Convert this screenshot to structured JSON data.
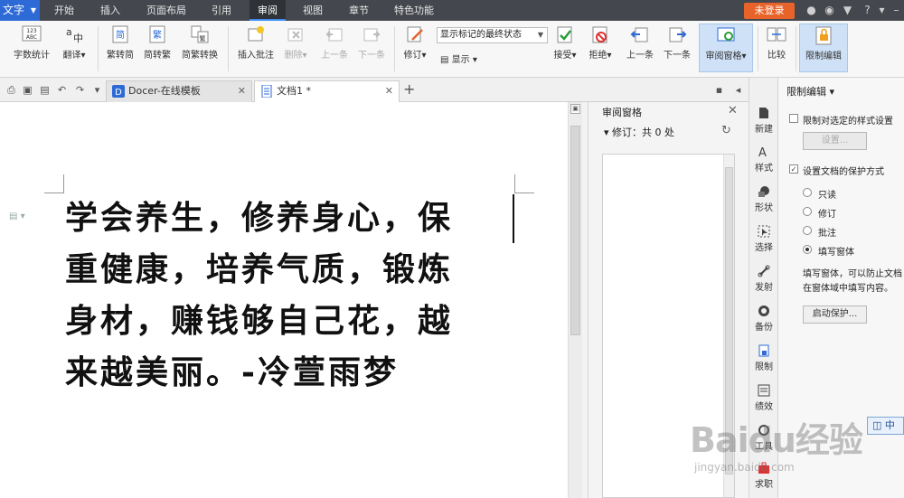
{
  "menubar": {
    "app_label": "文字",
    "tabs": [
      "开始",
      "插入",
      "页面布局",
      "引用",
      "审阅",
      "视图",
      "章节",
      "特色功能"
    ],
    "active_tab": "审阅",
    "login_label": "未登录"
  },
  "ribbon": {
    "word_count": "字数统计",
    "word_count_badge": "123 ABC",
    "translate": "翻译",
    "trad_to_simp": "繁转简",
    "simp_to_trad": "简转繁",
    "simp_trad_convert": "简繁转换",
    "insert_comment": "插入批注",
    "delete": "删除",
    "prev_comment": "上一条",
    "next_comment": "下一条",
    "track_changes": "修订",
    "show_marks_value": "显示标记的最终状态",
    "show": "显示",
    "accept": "接受",
    "reject": "拒绝",
    "prev_change": "上一条",
    "next_change": "下一条",
    "review_pane": "审阅窗格",
    "compare": "比较",
    "restrict_editing": "限制编辑"
  },
  "tabs": {
    "items": [
      {
        "label": "Docer-在线模板"
      },
      {
        "label": "文档1 *"
      }
    ]
  },
  "document": {
    "lines": [
      "学会养生，修养身心，保",
      "重健康，培养气质，锻炼",
      "身材，赚钱够自己花，越",
      "来越美丽。-冷萱雨梦"
    ]
  },
  "review_pane": {
    "title": "审阅窗格",
    "revision_count": "修订：共 0 处"
  },
  "sidebar": {
    "items": [
      {
        "label": "新建",
        "icon": "new-icon"
      },
      {
        "label": "样式",
        "icon": "style-icon"
      },
      {
        "label": "形状",
        "icon": "shape-icon"
      },
      {
        "label": "选择",
        "icon": "select-icon"
      },
      {
        "label": "发射",
        "icon": "link-icon"
      },
      {
        "label": "备份",
        "icon": "backup-icon"
      },
      {
        "label": "限制",
        "icon": "restrict-icon"
      },
      {
        "label": "绩效",
        "icon": "performance-icon"
      },
      {
        "label": "工具",
        "icon": "tools-icon"
      },
      {
        "label": "求职",
        "icon": "job-icon"
      }
    ]
  },
  "restrict_panel": {
    "title": "限制编辑",
    "limit_styles": "限制对选定的样式设置",
    "settings_btn": "设置...",
    "set_protection": "设置文档的保护方式",
    "options": [
      "只读",
      "修订",
      "批注",
      "填写窗体"
    ],
    "selected_option": "填写窗体",
    "desc_line1": "填写窗体，可以防止文档",
    "desc_line2": "在窗体域中填写内容。",
    "start_protect_btn": "启动保护...",
    "lang_button": "中"
  },
  "watermark": {
    "text": "Baidu经验",
    "sub": "jingyan.baidu.com"
  },
  "colors": {
    "app_button": "#2d6ad6",
    "login_button": "#e8632a",
    "menubar": "#44474d"
  }
}
